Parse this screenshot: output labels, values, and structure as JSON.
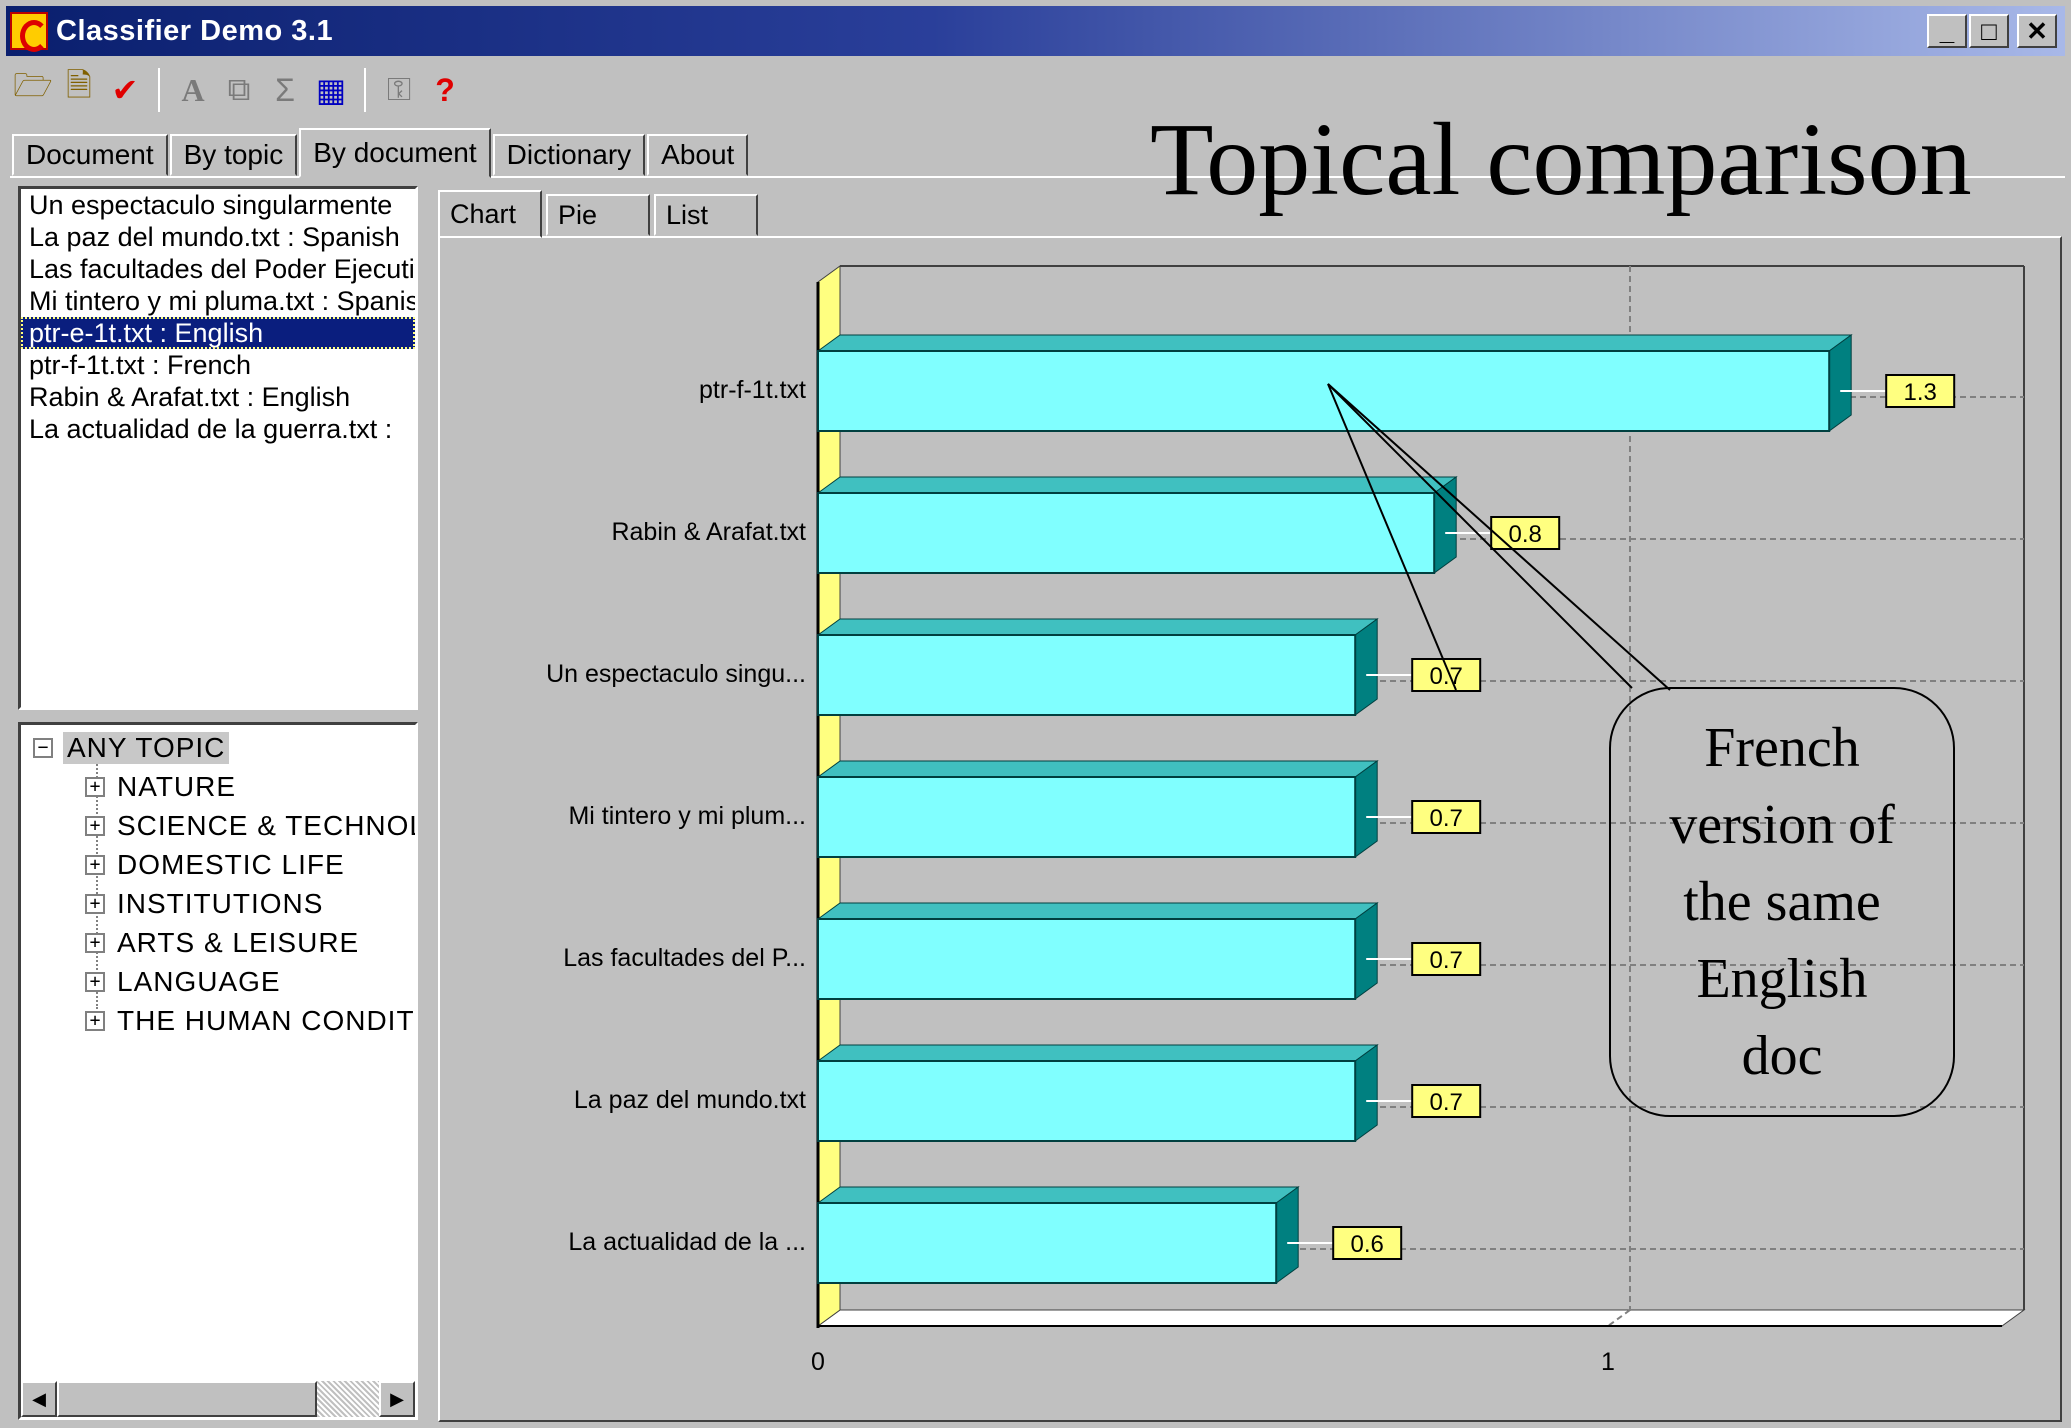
{
  "window": {
    "title": "Classifier Demo 3.1",
    "buttons": {
      "minimize": "_",
      "maximize": "□",
      "close": "✕"
    }
  },
  "toolbar": {
    "icons": [
      "open-folder-icon",
      "document-icon",
      "checkmark-icon",
      "font-icon",
      "copy-icon",
      "sigma-icon",
      "chart-icon",
      "key-icon",
      "help-icon"
    ],
    "glyphs": {
      "open": "🗁",
      "doc": "🗎",
      "check": "✔",
      "font": "A",
      "copy": "⧉",
      "sum": "Σ",
      "chart": "▦",
      "key": "⚿",
      "help": "?"
    }
  },
  "tabs": {
    "document": "Document",
    "by_topic": "By topic",
    "by_document": "By document",
    "dictionary": "Dictionary",
    "about": "About"
  },
  "heading": "Topical comparison",
  "doc_list": {
    "items": [
      "Un espectaculo singularmente",
      "La paz del mundo.txt : Spanish",
      "Las facultades del Poder Ejecutivo",
      "Mi tintero y mi pluma.txt : Spanish",
      "ptr-e-1t.txt : English",
      "ptr-f-1t.txt : French",
      "Rabin & Arafat.txt : English",
      "La actualidad de la guerra.txt :"
    ],
    "selected_index": 4
  },
  "topic_tree": {
    "root": "ANY TOPIC",
    "root_toggle": "−",
    "child_toggle": "+",
    "children": [
      "NATURE",
      "SCIENCE & TECHNOLOGY",
      "DOMESTIC LIFE",
      "INSTITUTIONS",
      "ARTS & LEISURE",
      "LANGUAGE",
      "THE HUMAN CONDITION"
    ]
  },
  "subtabs": {
    "chart": "Chart",
    "pie": "Pie",
    "list": "List"
  },
  "scrollbar": {
    "left": "◀",
    "right": "▶"
  },
  "chart_data": {
    "type": "bar",
    "orientation": "horizontal",
    "categories": [
      "ptr-f-1t.txt",
      "Rabin & Arafat.txt",
      "Un espectaculo singu...",
      "Mi tintero y mi plum...",
      "Las facultades del P...",
      "La paz del mundo.txt",
      "La actualidad de la ..."
    ],
    "values": [
      1.28,
      0.78,
      0.68,
      0.68,
      0.68,
      0.68,
      0.58
    ],
    "data_labels": [
      "1.3",
      "0.8",
      "0.7",
      "0.7",
      "0.7",
      "0.7",
      "0.6"
    ],
    "xlim": [
      0,
      1.5
    ],
    "x_ticks": [
      0,
      1
    ],
    "x_tick_labels": [
      "0",
      "1"
    ],
    "grid": true,
    "bar_color": "#80ffff",
    "bar_side_color": "#008080",
    "bar_top_color": "#40c0c0",
    "label_color": "#ffff80"
  },
  "callout": {
    "lines": [
      "French",
      "version of",
      "the same",
      "English",
      "doc"
    ]
  },
  "colors": {
    "face": "#c0c0c0",
    "title_bar_start": "#0a1f6e",
    "selection": "#0a1e7e"
  }
}
